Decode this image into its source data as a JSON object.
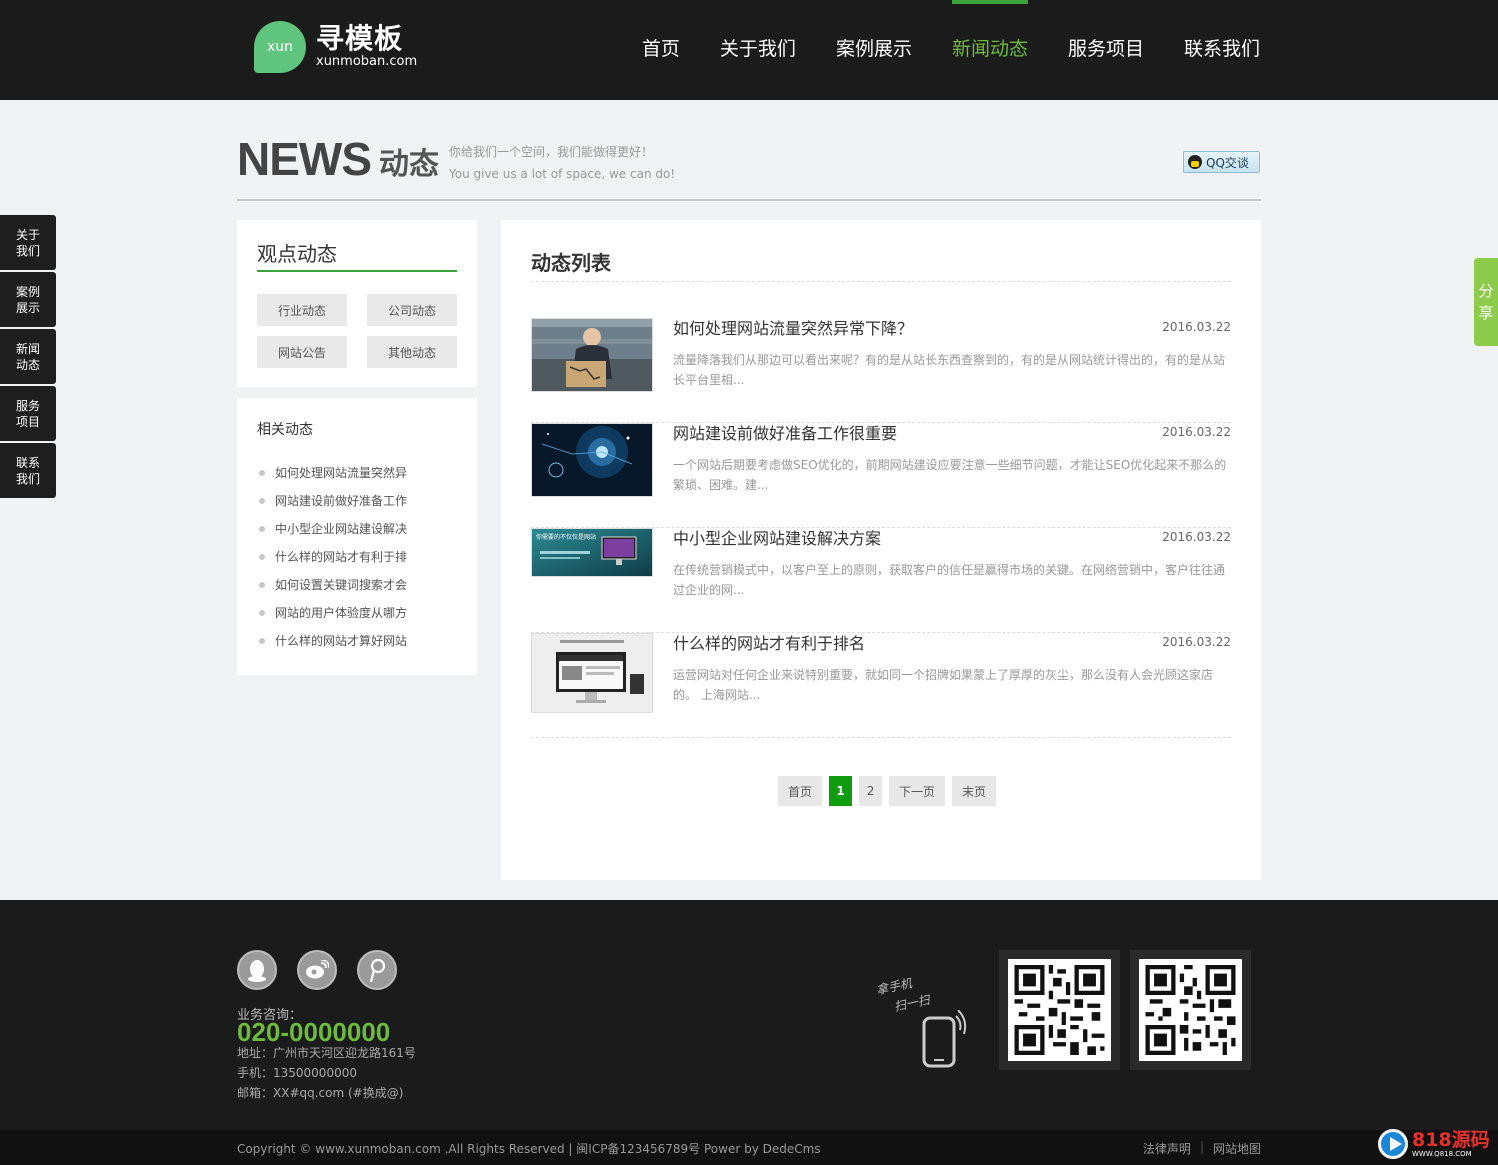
{
  "header": {
    "logo_badge": "xun",
    "logo_cn": "寻模板",
    "logo_en": "xunmoban.com",
    "nav": [
      "首页",
      "关于我们",
      "案例展示",
      "新闻动态",
      "服务项目",
      "联系我们"
    ],
    "active_nav": "新闻动态"
  },
  "page_title": {
    "en": "NEWS",
    "cn": "动态",
    "slogan_cn": "你给我们一个空间，我们能做得更好！",
    "slogan_en": "You give us a lot of space, we can do!",
    "qq_button": "QQ交谈"
  },
  "side_left": [
    "关于我们",
    "案例展示",
    "新闻动态",
    "服务项目",
    "联系我们"
  ],
  "share_tab": "分享",
  "sidebar": {
    "category_title": "观点动态",
    "categories": [
      "行业动态",
      "公司动态",
      "网站公告",
      "其他动态"
    ],
    "related_title": "相关动态",
    "related": [
      "如何处理网站流量突然异",
      "网站建设前做好准备工作",
      "中小型企业网站建设解决",
      "什么样的网站才有利于排",
      "如何设置关键词搜索才会",
      "网站的用户体验度从哪方",
      "什么样的网站才算好网站"
    ]
  },
  "main": {
    "title": "动态列表",
    "news": [
      {
        "title": "如何处理网站流量突然异常下降？",
        "date": "2016.03.22",
        "desc": "流量降落我们从那边可以看出来呢？有的是从站长东西查察到的，有的是从网站统计得出的，有的是从站长平台里相..."
      },
      {
        "title": "网站建设前做好准备工作很重要",
        "date": "2016.03.22",
        "desc": "一个网站后期要考虑做SEO优化的，前期网站建设应要注意一些细节问题，才能让SEO优化起来不那么的繁琐、困难。建..."
      },
      {
        "title": "中小型企业网站建设解决方案",
        "date": "2016.03.22",
        "desc": "在传统营销模式中，以客户至上的原则，获取客户的信任是赢得市场的关键。在网络营销中，客户往往通过企业的网..."
      },
      {
        "title": "什么样的网站才有利于排名",
        "date": "2016.03.22",
        "desc": "运营网站对任何企业来说特别重要，就如同一个招牌如果蒙上了厚厚的灰尘，那么没有人会光顾这家店的。 上海网站..."
      }
    ],
    "thumb3_caption": "你需要的不仅仅是网站",
    "pager": [
      "首页",
      "1",
      "2",
      "下一页",
      "末页"
    ],
    "pager_current": "1"
  },
  "footer": {
    "consult_label": "业务咨询：",
    "phone": "020-0000000",
    "address": "地址：广州市天河区迎龙路161号",
    "mobile": "手机：13500000000",
    "email": "邮箱：XX#qq.com (#换成@)",
    "scan_line1": "拿手机",
    "scan_line2": "扫一扫",
    "copyright": "Copyright © www.xunmoban.com .All Rights Reserved  |  闽ICP备123456789号 Power by DedeCms",
    "links": [
      "法律声明",
      "网站地图"
    ],
    "brand_main": "818源码",
    "brand_sub": "WWW.Q818.COM"
  }
}
